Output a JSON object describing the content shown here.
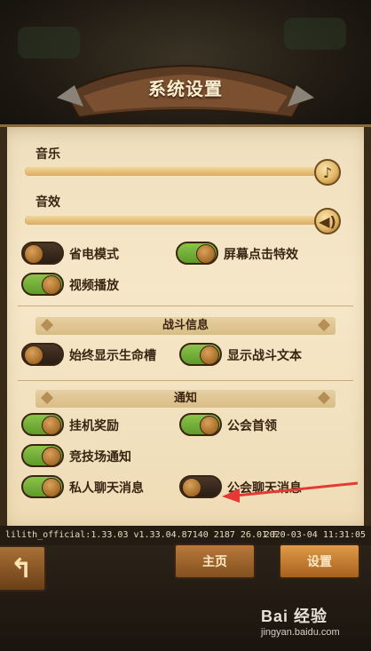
{
  "title": "系统设置",
  "sliders": {
    "music": {
      "label": "音乐",
      "level": 1.0,
      "icon": "music-note-icon"
    },
    "sfx": {
      "label": "音效",
      "level": 1.0,
      "icon": "speaker-icon"
    }
  },
  "toggles": {
    "power_saving": {
      "label": "省电模式",
      "on": false
    },
    "tap_effects": {
      "label": "屏幕点击特效",
      "on": true
    },
    "video_playback": {
      "label": "视频播放",
      "on": true
    }
  },
  "sections": {
    "battle_info": {
      "title": "战斗信息",
      "items": {
        "always_hp_bar": {
          "label": "始终显示生命槽",
          "on": false
        },
        "battle_text": {
          "label": "显示战斗文本",
          "on": true
        }
      }
    },
    "notifications": {
      "title": "通知",
      "items": {
        "afk_rewards": {
          "label": "挂机奖励",
          "on": true
        },
        "guild_boss": {
          "label": "公会首领",
          "on": true
        },
        "arena": {
          "label": "竞技场通知",
          "on": true
        },
        "private_chat": {
          "label": "私人聊天消息",
          "on": true
        },
        "guild_chat": {
          "label": "公会聊天消息",
          "on": false
        }
      }
    }
  },
  "version": {
    "left": "lilith_official:1.33.03  v1.33.04.87140 2187 26.01 F",
    "right": "2020-03-04 11:31:05"
  },
  "nav": {
    "back_icon": "back-arrow-icon",
    "home_label": "主页",
    "settings_label": "设置"
  },
  "watermark": {
    "top": "Bai 经验",
    "bottom": "jingyan.baidu.com"
  },
  "colors": {
    "toggle_on": "#6fae34",
    "toggle_off": "#3a2a1e",
    "parchment": "#f2e2c1",
    "annotation_arrow": "#e53935"
  }
}
